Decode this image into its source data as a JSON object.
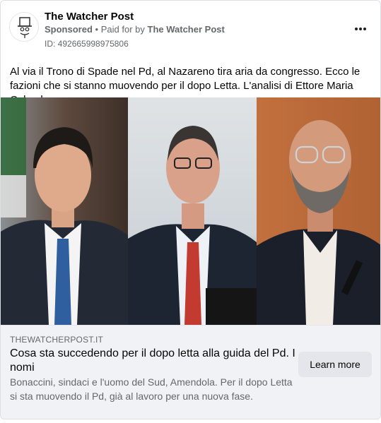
{
  "ad": {
    "page_name": "The Watcher Post",
    "sponsored_label": "Sponsored",
    "separator": "•",
    "paid_for_by_label": "Paid for by",
    "payer_name": "The Watcher Post",
    "ad_id": "ID: 492665998975806",
    "more_icon": "more-horizontal-icon",
    "body_text": "Al via il Trono di Spade nel Pd, al Nazareno tira aria da congresso. Ecco le fazioni che si stanno muovendo per il dopo Letta. L'analisi di Ettore Maria Colombo."
  },
  "link": {
    "domain": "THEWATCHERPOST.IT",
    "headline": "Cosa sta succedendo per il dopo letta alla guida del Pd. I nomi",
    "description": "Bonaccini, sindaci e l'uomo del Sud, Amendola. Per il dopo Letta si sta muovendo il Pd, già al lavoro per una nuova fase.",
    "cta_label": "Learn more"
  },
  "colors": {
    "secondary_text": "#65676b",
    "footer_bg": "#f0f2f5",
    "button_bg": "#e4e6eb"
  }
}
